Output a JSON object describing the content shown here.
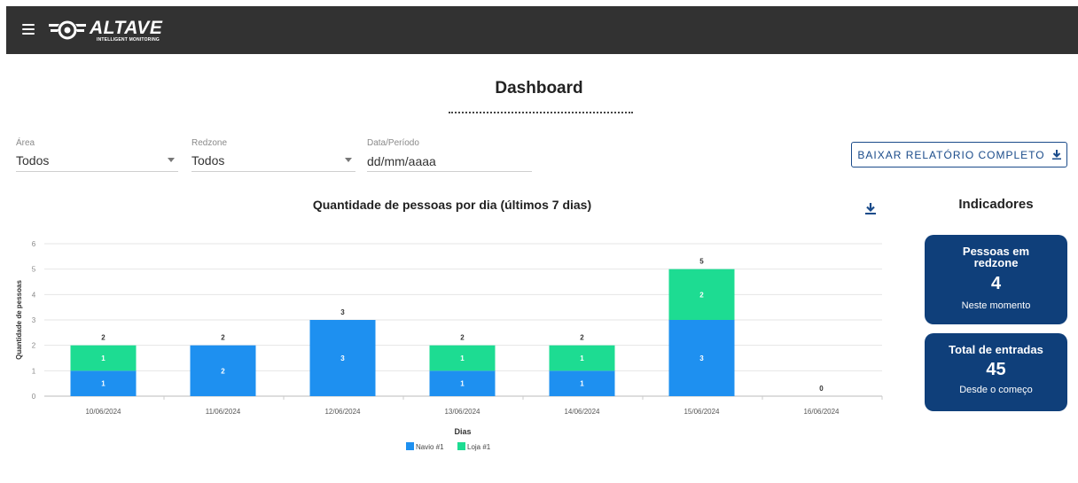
{
  "header": {
    "logo_word": "ALTAVE",
    "logo_sub": "INTELLIGENT MONITORING",
    "menu_icon": "hamburger-menu-icon"
  },
  "page": {
    "title": "Dashboard"
  },
  "filters": {
    "area": {
      "label": "Área",
      "value": "Todos"
    },
    "redzone": {
      "label": "Redzone",
      "value": "Todos"
    },
    "date": {
      "label": "Data/Período",
      "value": "dd/mm/aaaa"
    },
    "report_button": "BAIXAR RELATÓRIO COMPLETO",
    "download_icon": "download-icon"
  },
  "indicators": {
    "title": "Indicadores",
    "redzone_card": {
      "label": "Pessoas em redzone",
      "value": "4",
      "sub": "Neste momento"
    },
    "entries_card": {
      "label": "Total de entradas",
      "value": "45",
      "sub": "Desde o começo"
    }
  },
  "colors": {
    "navio": "#1e90f0",
    "loja": "#1ddc92",
    "card": "#0f3f7a",
    "header": "#323232",
    "accent": "#1a4b8a"
  },
  "chart_data": {
    "type": "bar",
    "stacked": true,
    "title": "Quantidade de pessoas por dia (últimos 7 dias)",
    "xlabel": "Dias",
    "ylabel": "Quantidade de pessoas",
    "ylim": [
      0,
      6
    ],
    "yticks": [
      0,
      1,
      2,
      3,
      4,
      5,
      6
    ],
    "categories": [
      "10/06/2024",
      "11/06/2024",
      "12/06/2024",
      "13/06/2024",
      "14/06/2024",
      "15/06/2024",
      "16/06/2024"
    ],
    "series": [
      {
        "name": "Navio #1",
        "values": [
          1,
          2,
          3,
          1,
          1,
          3,
          0
        ]
      },
      {
        "name": "Loja #1",
        "values": [
          1,
          0,
          0,
          1,
          1,
          2,
          0
        ]
      }
    ],
    "totals": [
      2,
      2,
      3,
      2,
      2,
      5,
      0
    ],
    "grid": true,
    "legend": "bottom-center"
  }
}
